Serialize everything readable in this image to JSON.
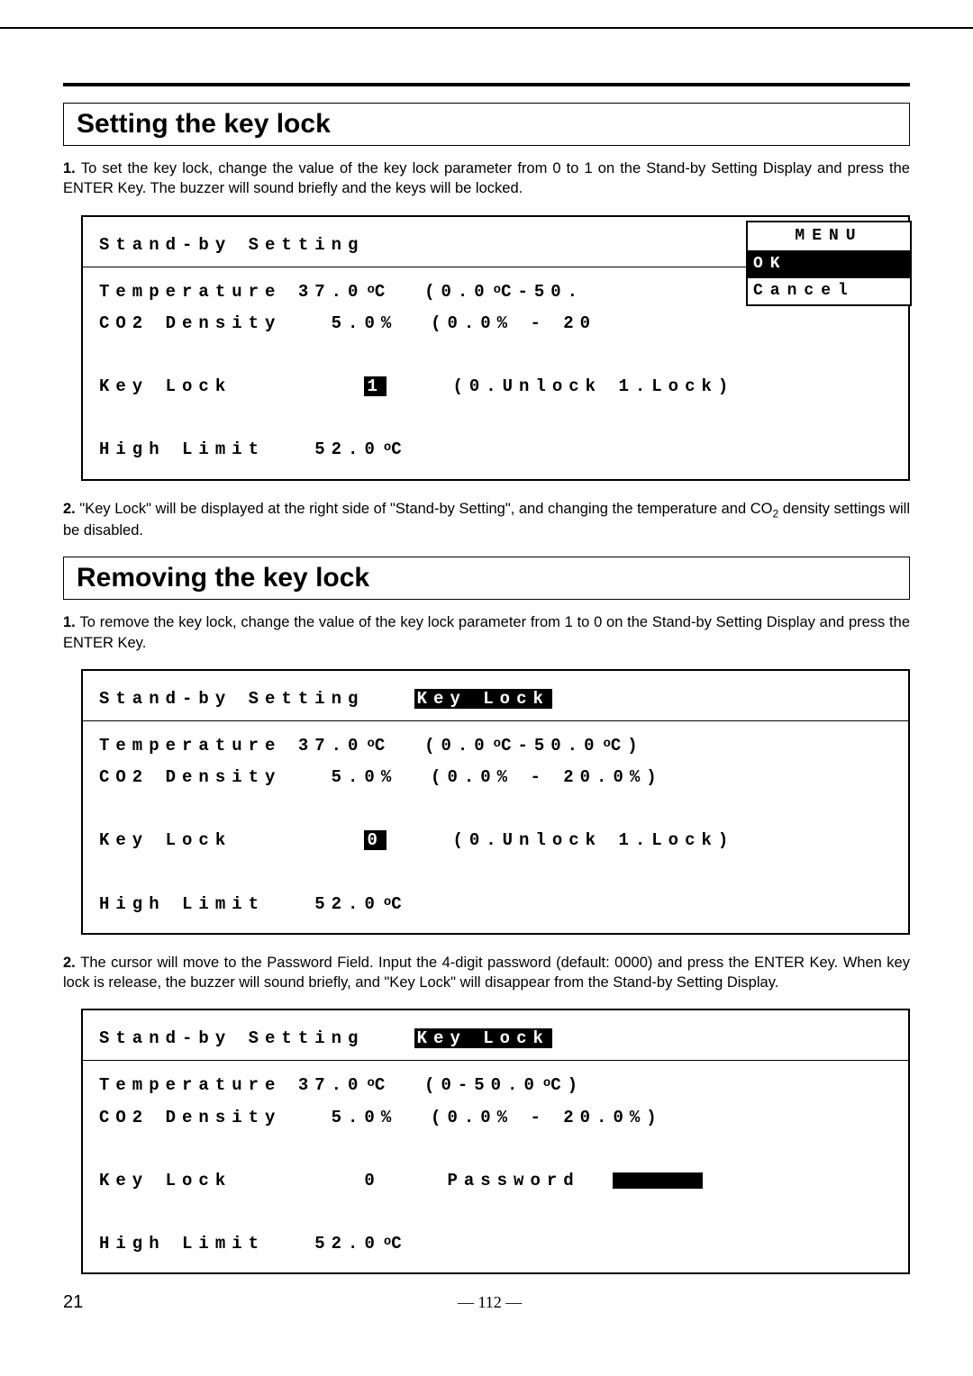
{
  "sections": {
    "set": {
      "title": "Setting the key lock",
      "step1": "To set the key lock, change the value of the key lock parameter from 0 to 1 on the Stand-by Setting Display and press the ENTER Key. The buzzer will sound briefly and the keys will be locked.",
      "step2a": "\"Key Lock\" will be displayed at the right side of \"Stand-by Setting\", and changing the temperature and CO",
      "step2b": " density settings will be disabled."
    },
    "remove": {
      "title": "Removing the key lock",
      "step1": "To remove the key lock, change the value of the key lock parameter from 1 to 0 on the Stand-by Setting Display and press the ENTER Key.",
      "step2": "The cursor will move to the Password Field. Input the 4-digit password (default: 0000) and press the ENTER Key. When key lock is release, the buzzer will sound briefly, and \"Key Lock\" will disappear from the Stand-by Setting Display."
    }
  },
  "panel1": {
    "header": "Stand-by Setting",
    "temp_label": "Temperature",
    "temp_value": "37.0",
    "temp_range": "(0.0",
    "temp_range_end": "C-50.",
    "co2_label": "CO2 Density",
    "co2_value": "5.0%",
    "co2_range": "(0.0% - 20",
    "keylock_label": "Key Lock",
    "keylock_value": "1",
    "keylock_hint": "(0.Unlock 1.Lock)",
    "highlimit_label": "High Limit",
    "highlimit_value": "52.0",
    "menu": {
      "title": "MENU",
      "ok": "OK",
      "cancel": "Cancel"
    }
  },
  "panel2": {
    "header": "Stand-by Setting",
    "badge": "Key Lock",
    "temp_label": "Temperature",
    "temp_value": "37.0",
    "temp_range1": "(0.0",
    "temp_range2": "C-50.0",
    "temp_range3": "C)",
    "co2_line": "CO2 Density   5.0%  (0.0% - 20.0%)",
    "keylock_label": "Key Lock",
    "keylock_value": "0",
    "keylock_hint": "(0.Unlock 1.Lock)",
    "highlimit_label": "High Limit",
    "highlimit_value": "52.0"
  },
  "panel3": {
    "header": "Stand-by Setting",
    "badge": "Key Lock",
    "temp_label": "Temperature",
    "temp_value": "37.0",
    "temp_range": "C  (0-50.0",
    "temp_range_end": "C)",
    "co2_line": "CO2 Density   5.0%  (0.0% - 20.0%)",
    "keylock_line": "Key Lock        0    Password",
    "highlimit_label": "High Limit",
    "highlimit_value": "52.0"
  },
  "footer": {
    "left": "21",
    "center": "— 112 —"
  }
}
